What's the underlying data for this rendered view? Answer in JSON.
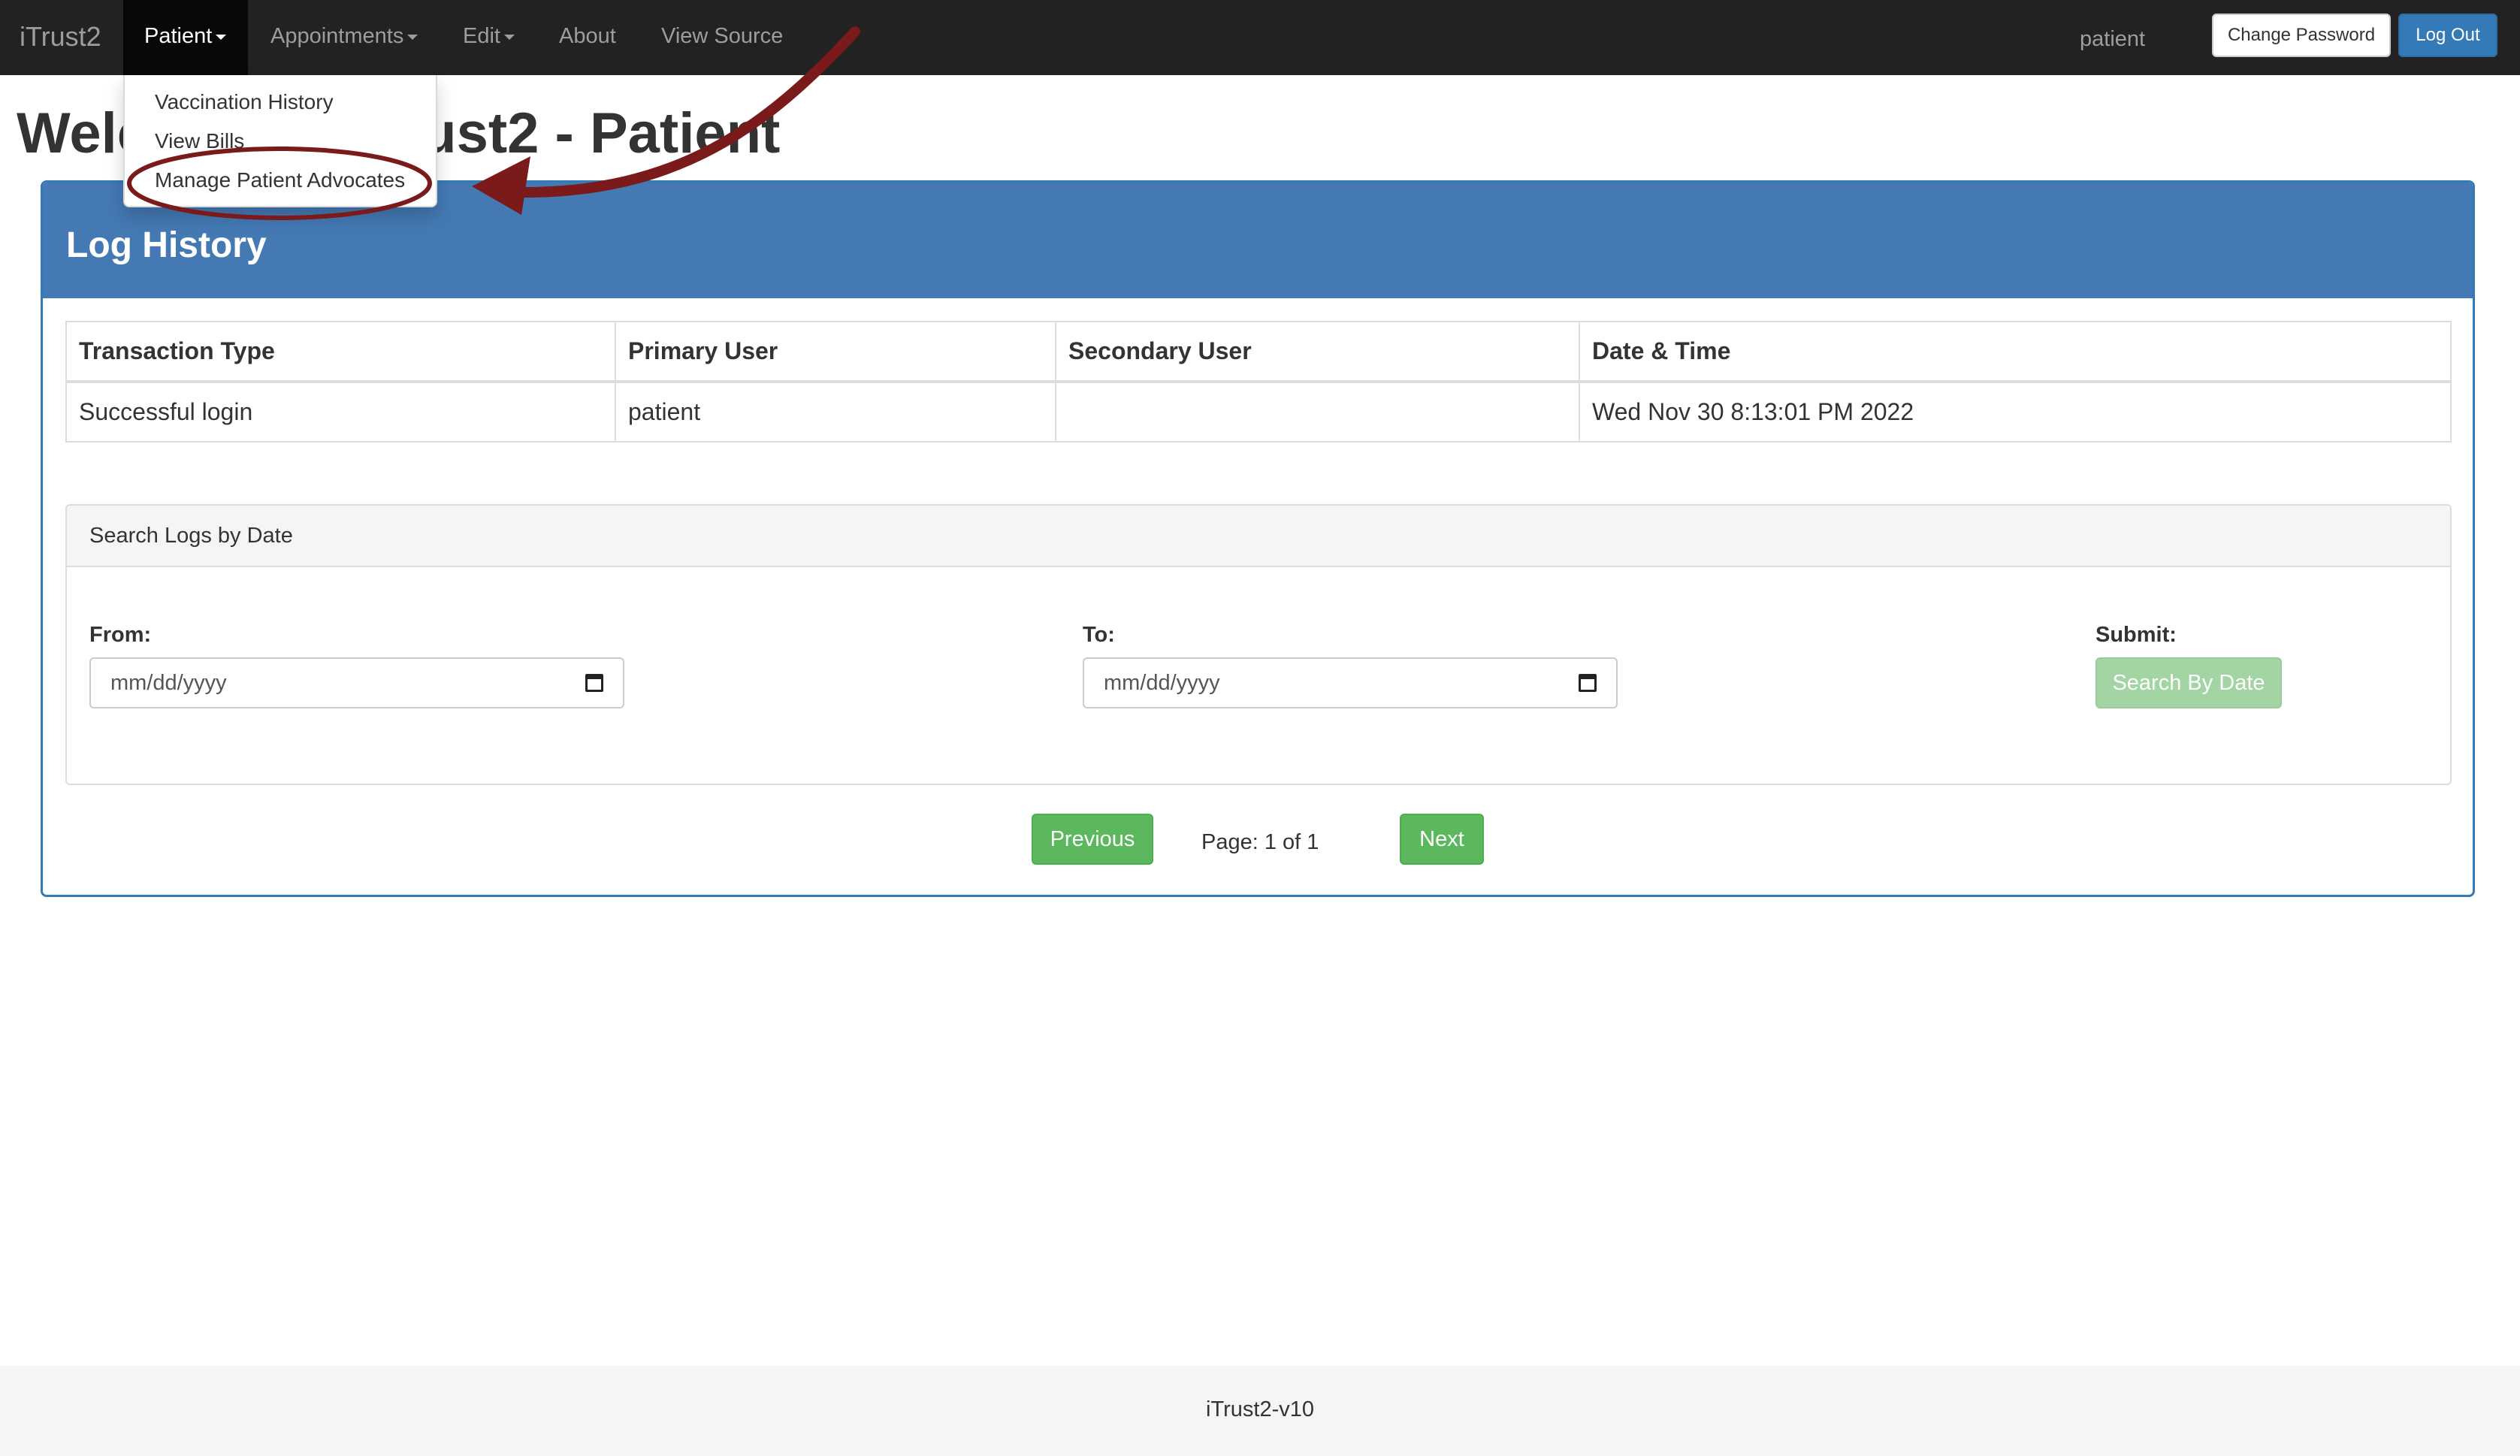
{
  "navbar": {
    "brand": "iTrust2",
    "items": [
      {
        "label": "Patient"
      },
      {
        "label": "Appointments"
      },
      {
        "label": "Edit"
      },
      {
        "label": "About"
      },
      {
        "label": "View Source"
      }
    ],
    "username": "patient",
    "change_password_label": "Change Password",
    "logout_label": "Log Out"
  },
  "dropdown": {
    "items": [
      {
        "label": "Vaccination History"
      },
      {
        "label": "View Bills"
      },
      {
        "label": "Manage Patient Advocates"
      }
    ],
    "highlighted_item": "Manage Patient Advocates"
  },
  "page_title": "Welcome to iTrust2 - Patient",
  "log_panel": {
    "title": "Log History",
    "columns": [
      "Transaction Type",
      "Primary User",
      "Secondary User",
      "Date & Time"
    ],
    "rows": [
      [
        "Successful login",
        "patient",
        "",
        "Wed Nov 30 8:13:01 PM 2022"
      ]
    ]
  },
  "search": {
    "title": "Search Logs by Date",
    "from_label": "From:",
    "from_placeholder": "mm/dd/yyyy",
    "to_label": "To:",
    "to_placeholder": "mm/dd/yyyy",
    "submit_label": "Submit:",
    "submit_button": "Search By Date"
  },
  "pager": {
    "previous_label": "Previous",
    "page_info": "Page: 1 of 1",
    "next_label": "Next"
  },
  "footer": {
    "version": "iTrust2-v10"
  },
  "colors": {
    "navbar_bg": "#222222",
    "panel_primary": "#4479b4",
    "success_green": "#5cb85c",
    "annotation_red": "#7a1a1a"
  }
}
